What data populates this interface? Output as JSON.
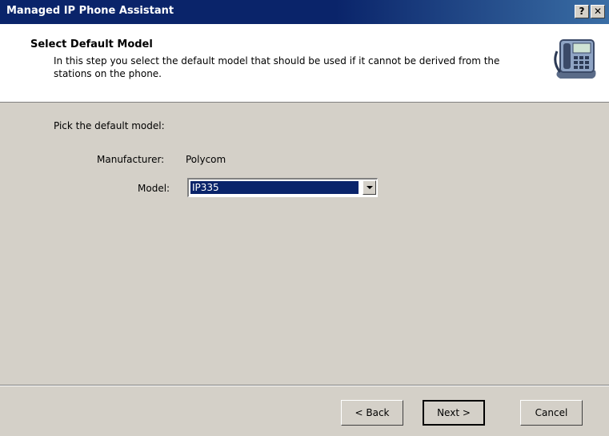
{
  "window": {
    "title": "Managed IP Phone Assistant",
    "help_label": "?",
    "close_label": "✕"
  },
  "header": {
    "title": "Select Default Model",
    "description": "In this step you select the default model that should be used if it cannot be derived from the stations on the phone.",
    "icon": "phone-icon"
  },
  "form": {
    "prompt": "Pick the default model:",
    "manufacturer_label": "Manufacturer:",
    "manufacturer_value": "Polycom",
    "model_label": "Model:",
    "model_value": "IP335"
  },
  "buttons": {
    "back_label": "< Back",
    "next_label": "Next >",
    "cancel_label": "Cancel"
  },
  "colors": {
    "titlebar": "#0a246a",
    "dialog_bg": "#d4d0c8",
    "header_bg": "#ffffff",
    "selection": "#0a246a"
  }
}
